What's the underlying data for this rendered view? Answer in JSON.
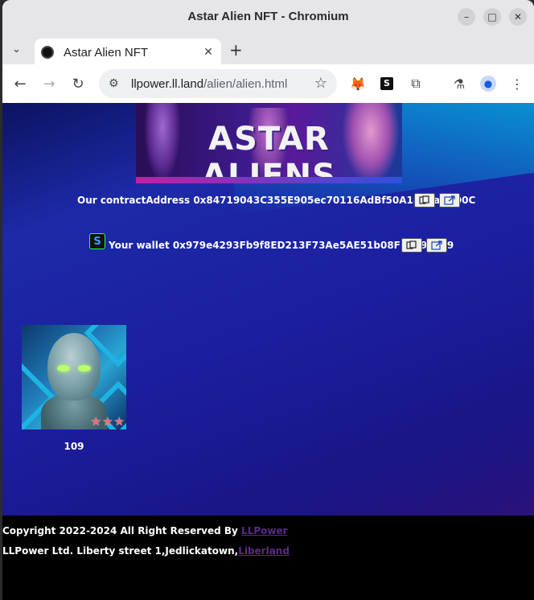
{
  "window": {
    "title": "Astar Alien NFT - Chromium"
  },
  "tab": {
    "title": "Astar Alien NFT"
  },
  "address_bar": {
    "host": "llpower.ll.land",
    "path": "/alien/alien.html"
  },
  "banner": {
    "text": "ASTAR ALIENS"
  },
  "contract": {
    "label": "Our contractAddress 0x84719043C355E905ec70116AdBf50A1828a7CD0C"
  },
  "wallet": {
    "label": "Your wallet 0x979e4293Fb9f8ED213F73Ae5AE51b08F11498ae9",
    "icon_letter": "S"
  },
  "nft": {
    "id": "109",
    "stars": 3
  },
  "footer": {
    "copyright": "Copyright 2022-2024 All Right Reserved By ",
    "copyright_link": "LLPower",
    "address": "LLPower Ltd. Liberty street 1,Jedlickatown,",
    "address_link": "Liberland"
  },
  "colors": {
    "footer_link": "#5b2a86",
    "page_bg": "#1b1fa0",
    "footer_bg": "#000000"
  }
}
